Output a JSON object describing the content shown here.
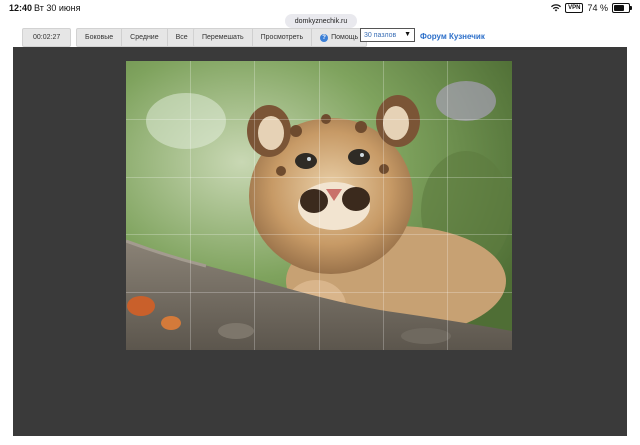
{
  "status_bar": {
    "time": "12:40",
    "date": "Вт 30 июня",
    "vpn": "VPN",
    "battery_text": "74 %",
    "battery_level": 0.74
  },
  "browser": {
    "url": "domkyznechik.ru"
  },
  "toolbar": {
    "timer": "00:02:27",
    "filter_side": "Боковые",
    "filter_middle": "Средние",
    "filter_all": "Все",
    "shuffle": "Перемешать",
    "preview": "Просмотреть",
    "help": "Помощь",
    "pieces_select": "30 пазлов",
    "forum_link": "Форум Кузнечик"
  },
  "colors": {
    "workspace_bg": "#3a3a3a",
    "link": "#2c6fc9",
    "toolbar_bg": "#e6e6e6"
  },
  "puzzle": {
    "image_subject": "cougar-cub-photo",
    "columns": 6,
    "rows": 5
  }
}
